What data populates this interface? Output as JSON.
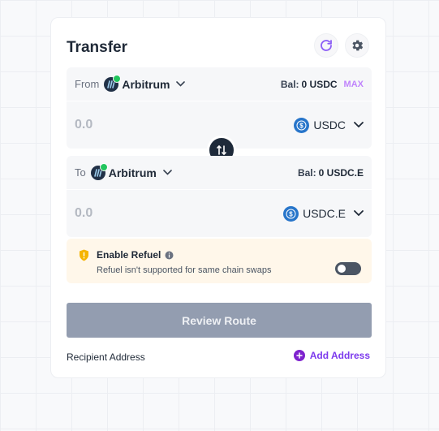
{
  "transfer": {
    "title": "Transfer",
    "refresh_icon": "refresh-icon",
    "settings_icon": "gear-icon"
  },
  "from": {
    "label": "From",
    "chain": "Arbitrum",
    "balance_label": "Bal:",
    "balance_value": "0 USDC",
    "max_label": "MAX",
    "amount_placeholder": "0.0",
    "token": "USDC"
  },
  "swap": {
    "icon": "swap-arrows-icon"
  },
  "to": {
    "label": "To",
    "chain": "Arbitrum",
    "balance_label": "Bal:",
    "balance_value": "0 USDC.E",
    "amount_placeholder": "0.0",
    "token": "USDC.E"
  },
  "refuel": {
    "title": "Enable Refuel",
    "subtitle": "Refuel isn't supported for same chain swaps",
    "enabled": false
  },
  "review_button": "Review Route",
  "recipient": {
    "label": "Recipient Address",
    "add_label": "Add Address"
  },
  "colors": {
    "accent": "#7c3aed",
    "button_disabled": "#939db0",
    "refuel_bg": "#fff7ea",
    "usdc": "#2775ca",
    "arbitrum": "#213147"
  }
}
